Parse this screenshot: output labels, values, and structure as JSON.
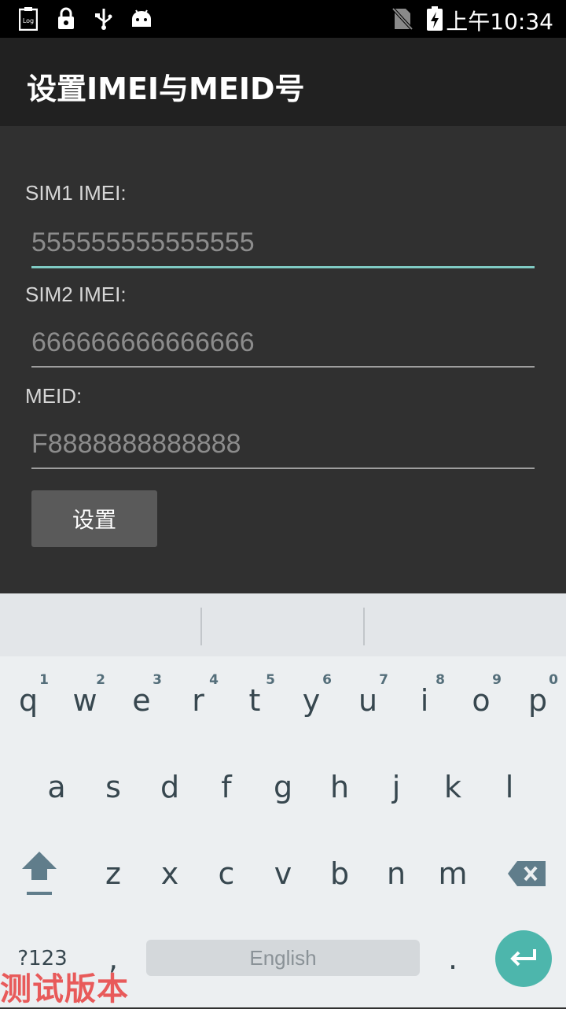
{
  "status_bar": {
    "time": "上午10:34",
    "icons": [
      "log-icon",
      "lock-icon",
      "usb-icon",
      "android-icon",
      "no-sim-icon",
      "battery-charging-icon"
    ]
  },
  "app_bar": {
    "title": "设置IMEI与MEID号"
  },
  "form": {
    "sim1_label": "SIM1 IMEI:",
    "sim1_placeholder": "555555555555555",
    "sim2_label": "SIM2 IMEI:",
    "sim2_placeholder": "666666666666666",
    "meid_label": "MEID:",
    "meid_placeholder": "F8888888888888",
    "submit_label": "设置"
  },
  "keyboard": {
    "row1": [
      {
        "key": "q",
        "hint": "1"
      },
      {
        "key": "w",
        "hint": "2"
      },
      {
        "key": "e",
        "hint": "3"
      },
      {
        "key": "r",
        "hint": "4"
      },
      {
        "key": "t",
        "hint": "5"
      },
      {
        "key": "y",
        "hint": "6"
      },
      {
        "key": "u",
        "hint": "7"
      },
      {
        "key": "i",
        "hint": "8"
      },
      {
        "key": "o",
        "hint": "9"
      },
      {
        "key": "p",
        "hint": "0"
      }
    ],
    "row2": [
      "a",
      "s",
      "d",
      "f",
      "g",
      "h",
      "j",
      "k",
      "l"
    ],
    "row3": [
      "z",
      "x",
      "c",
      "v",
      "b",
      "n",
      "m"
    ],
    "symbols_key": "?123",
    "comma_key": ",",
    "space_label": "English",
    "period_key": "."
  },
  "watermark": "测试版本"
}
